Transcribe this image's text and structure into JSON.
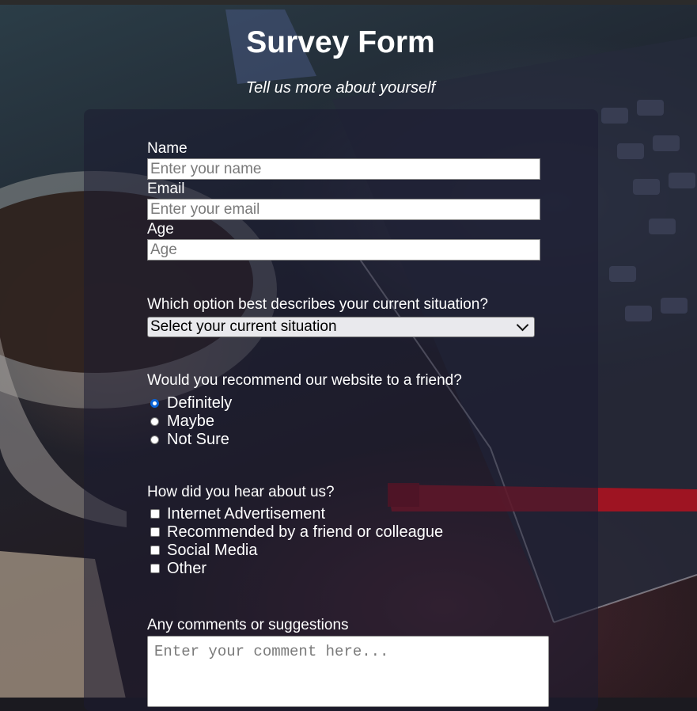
{
  "header": {
    "title": "Survey Form",
    "subtitle": "Tell us more about yourself"
  },
  "fields": {
    "name": {
      "label": "Name",
      "placeholder": "Enter your name",
      "value": ""
    },
    "email": {
      "label": "Email",
      "placeholder": "Enter your email",
      "value": ""
    },
    "age": {
      "label": "Age",
      "placeholder": "Age",
      "value": ""
    }
  },
  "situation": {
    "question": "Which option best describes your current situation?",
    "selected": "Select your current situation"
  },
  "recommend": {
    "question": "Would you recommend our website to a friend?",
    "options": [
      {
        "label": "Definitely",
        "checked": true
      },
      {
        "label": "Maybe",
        "checked": false
      },
      {
        "label": "Not Sure",
        "checked": false
      }
    ]
  },
  "hear": {
    "question": "How did you hear about us?",
    "options": [
      {
        "label": "Internet Advertisement",
        "checked": false
      },
      {
        "label": "Recommended by a friend or colleague",
        "checked": false
      },
      {
        "label": "Social Media",
        "checked": false
      },
      {
        "label": "Other",
        "checked": false
      }
    ]
  },
  "comments": {
    "label": "Any comments or suggestions",
    "placeholder": "Enter your comment here..."
  },
  "colors": {
    "accent": "#0a63d6",
    "panel": "rgba(27,27,50,0.55)"
  }
}
